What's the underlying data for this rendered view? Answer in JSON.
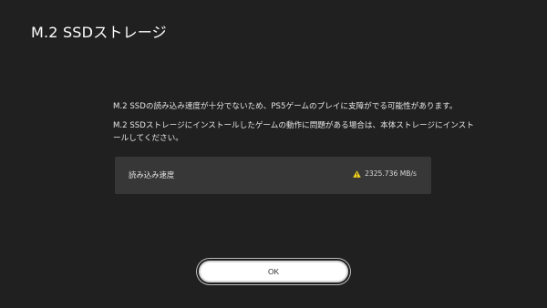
{
  "header": {
    "title": "M.2 SSDストレージ"
  },
  "message": {
    "line1": "M.2 SSDの読み込み速度が十分でないため、PS5ゲームのプレイに支障がでる可能性があります。",
    "line2": "M.2 SSDストレージにインストールしたゲームの動作に問題がある場合は、本体ストレージにインストールしてください。"
  },
  "speed_panel": {
    "label": "読み込み速度",
    "value": "2325.736 MB/s",
    "warning_icon": "warning-triangle-icon",
    "warning_color": "#f2d21b"
  },
  "actions": {
    "ok_label": "OK"
  },
  "colors": {
    "background": "#202020",
    "panel": "#373737",
    "button": "#ffffff"
  }
}
